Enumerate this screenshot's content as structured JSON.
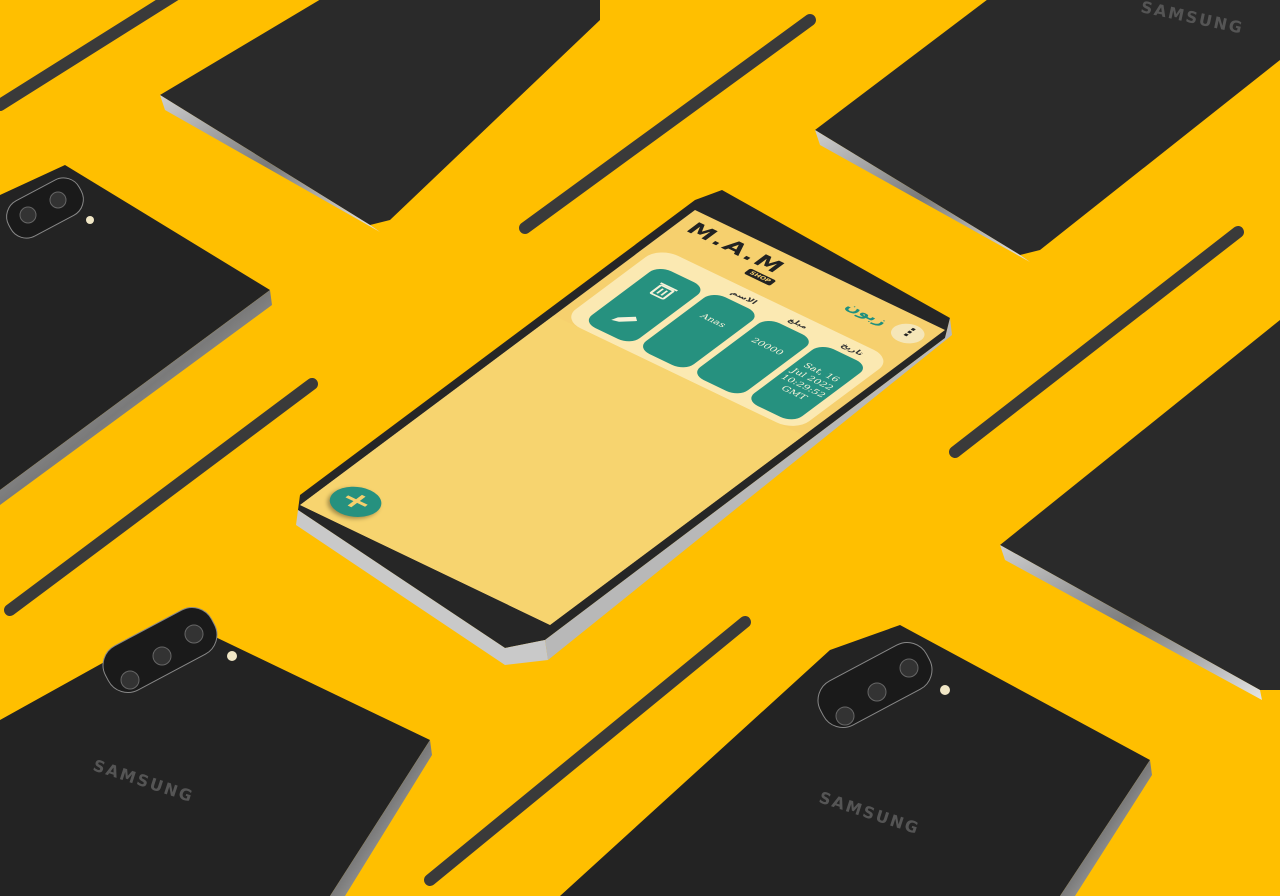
{
  "background_color": "#ffbf00",
  "device_brand": "SAMSUNG",
  "app": {
    "logo_text": "M.A.M",
    "logo_subtext": "SHOP",
    "title": "زبون",
    "menu_icon": "more-vert-icon",
    "accent_color": "#26917f",
    "screen_color": "#f6d06e"
  },
  "record": {
    "headers": {
      "date": "تاريخ",
      "amount": "مبلغ",
      "name": "الاسم"
    },
    "date_value": "Sat, 16 Jul 2022 10:29:52 GMT",
    "amount_value": "20000",
    "name_value": "Anas",
    "delete_icon": "trash-icon",
    "edit_icon": "pencil-icon"
  },
  "fab": {
    "label": "+",
    "icon": "plus-icon"
  }
}
